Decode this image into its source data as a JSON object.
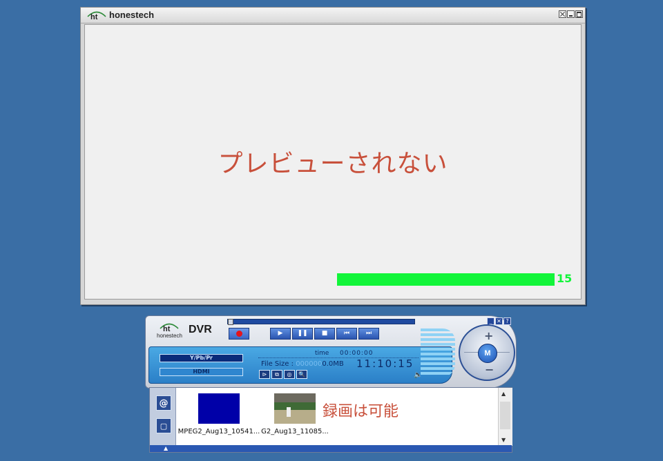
{
  "preview_window": {
    "brand_mark": "ht",
    "brand_name": "honestech",
    "message": "プレビューされない",
    "level": {
      "value": 15,
      "fill_fraction": 1.0
    }
  },
  "dvr_panel": {
    "logo_mark": "ht",
    "logo_sub": "honestech",
    "name": "DVR",
    "controls": {
      "record": "record-icon",
      "play": "▶",
      "pause": "❚❚",
      "stop": "■",
      "prev": "⏮",
      "next": "⏭"
    },
    "window_buttons": [
      "_",
      "✕",
      "?"
    ],
    "sources": [
      "Y/Pb/Pr",
      "HDMI"
    ],
    "time_label": "time",
    "time_value": "00:00:00",
    "file_size_label": "File Size :",
    "file_size_zeros": "000000",
    "file_size_value": "0.0MB",
    "clock": "11:10:15",
    "func_icons": [
      "⊳",
      "⧉",
      "◎",
      "🔍"
    ],
    "speaker": "🔈",
    "knob": {
      "plus": "+",
      "minus": "−",
      "center": "M"
    }
  },
  "library": {
    "side_buttons": [
      "@",
      "▢"
    ],
    "clips": [
      {
        "label": "MPEG2_Aug13_10541...",
        "thumb": "blue"
      },
      {
        "label": "G2_Aug13_11085...",
        "thumb": "game"
      }
    ],
    "record_ok": "録画は可能",
    "scroll_up": "▲",
    "scroll_down": "▼",
    "bottom_arrow": "▲"
  },
  "colors": {
    "desktop": "#3a6ea5",
    "level": "#12f53a",
    "annotation": "#c8503b",
    "record_dot": "#e5141b"
  }
}
